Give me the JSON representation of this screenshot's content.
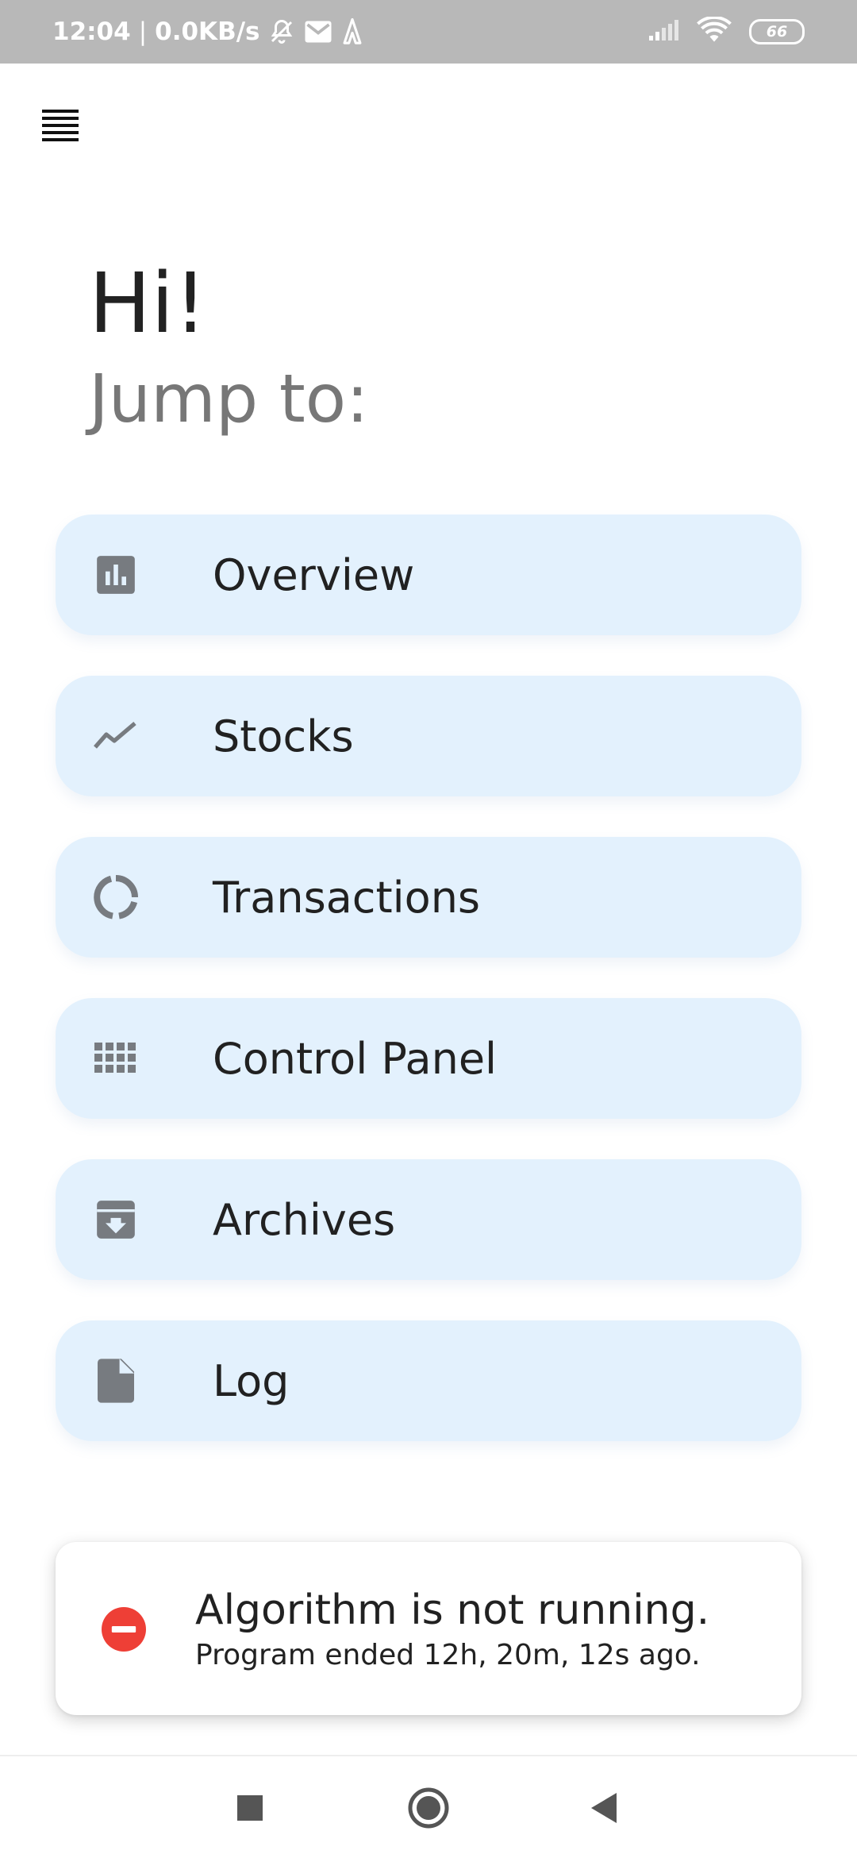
{
  "status_bar": {
    "time": "12:04",
    "separator": "|",
    "net_speed": "0.0KB/s",
    "battery": "66",
    "icons": [
      "mute-icon",
      "mail-icon",
      "app-notification-icon",
      "signal-icon",
      "wifi-icon",
      "battery-icon"
    ]
  },
  "header": {
    "menu_icon": "hamburger-menu-icon",
    "greeting": "Hi!",
    "subtitle": "Jump to:"
  },
  "nav": {
    "items": [
      {
        "label": "Overview",
        "icon": "bar-chart-icon"
      },
      {
        "label": "Stocks",
        "icon": "trending-line-icon"
      },
      {
        "label": "Transactions",
        "icon": "donut-chart-icon"
      },
      {
        "label": "Control Panel",
        "icon": "grid-icon"
      },
      {
        "label": "Archives",
        "icon": "archive-icon"
      },
      {
        "label": "Log",
        "icon": "document-icon"
      }
    ]
  },
  "status_card": {
    "icon": "stop-circle-icon",
    "title": "Algorithm is not running.",
    "detail": "Program ended 12h, 20m, 12s ago."
  },
  "system_nav": {
    "buttons": [
      "recents-button",
      "home-button",
      "back-button"
    ]
  },
  "colors": {
    "status_bar_bg": "#b8b8b8",
    "card_bg": "#e3f1fd",
    "icon_gray": "#777b80",
    "error_red": "#ee3f36",
    "text_primary": "#212121",
    "text_secondary": "#777777"
  }
}
